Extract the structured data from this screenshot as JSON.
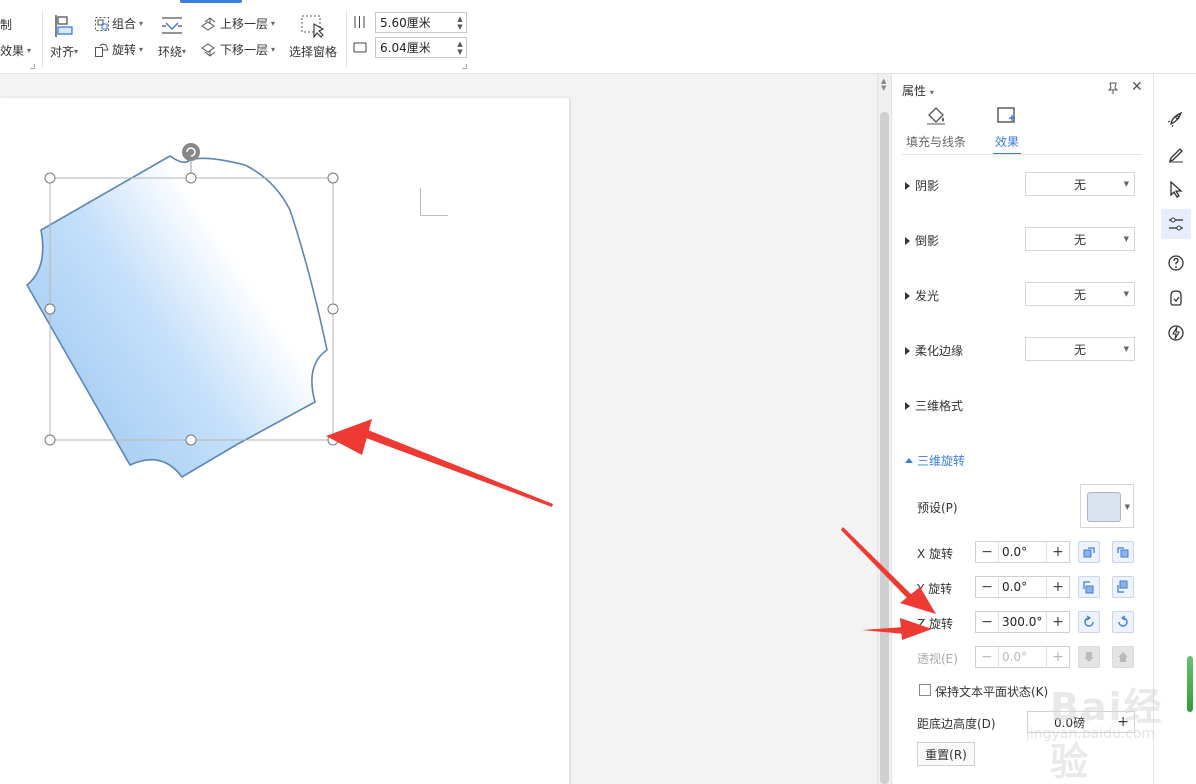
{
  "ribbon": {
    "copy_partial": "制",
    "effect_partial": "效果",
    "align": "对齐",
    "group": "组合",
    "rotate": "旋转",
    "wrap": "环绕",
    "bring_forward": "上移一层",
    "send_backward": "下移一层",
    "selection_pane": "选择窗格",
    "height_value": "5.60厘米",
    "width_value": "6.04厘米"
  },
  "panel": {
    "title": "属性",
    "tabs": [
      {
        "label": "填充与线条",
        "active": false
      },
      {
        "label": "效果",
        "active": true
      }
    ],
    "sections": {
      "shadow": {
        "label": "阴影",
        "value": "无"
      },
      "reflection": {
        "label": "倒影",
        "value": "无"
      },
      "glow": {
        "label": "发光",
        "value": "无"
      },
      "soft_edges": {
        "label": "柔化边缘",
        "value": "无"
      },
      "format_3d": {
        "label": "三维格式"
      },
      "rotation_3d": {
        "label": "三维旋转"
      }
    },
    "rotation": {
      "preset_label": "预设(P)",
      "x_label": "X 旋转",
      "x_value": "0.0°",
      "y_label": "Y 旋转",
      "y_value": "0.0°",
      "z_label": "Z 旋转",
      "z_value": "300.0°",
      "perspective_label": "透视(E)",
      "perspective_value": "0.0°",
      "keep_text_flat_label": "保持文本平面状态(K)",
      "distance_label": "距底边高度(D)",
      "distance_value": "0.0磅",
      "reset_label": "重置(R)"
    }
  },
  "watermark": {
    "text": "Bai经验",
    "url": "jingyan.baidu.com"
  },
  "colors": {
    "accent": "#3b7ddd",
    "shape_stroke": "#5b86b4",
    "shape_fill_light": "#ffffff",
    "shape_fill_blue": "#c3def8",
    "arrow": "#ee3a32"
  }
}
